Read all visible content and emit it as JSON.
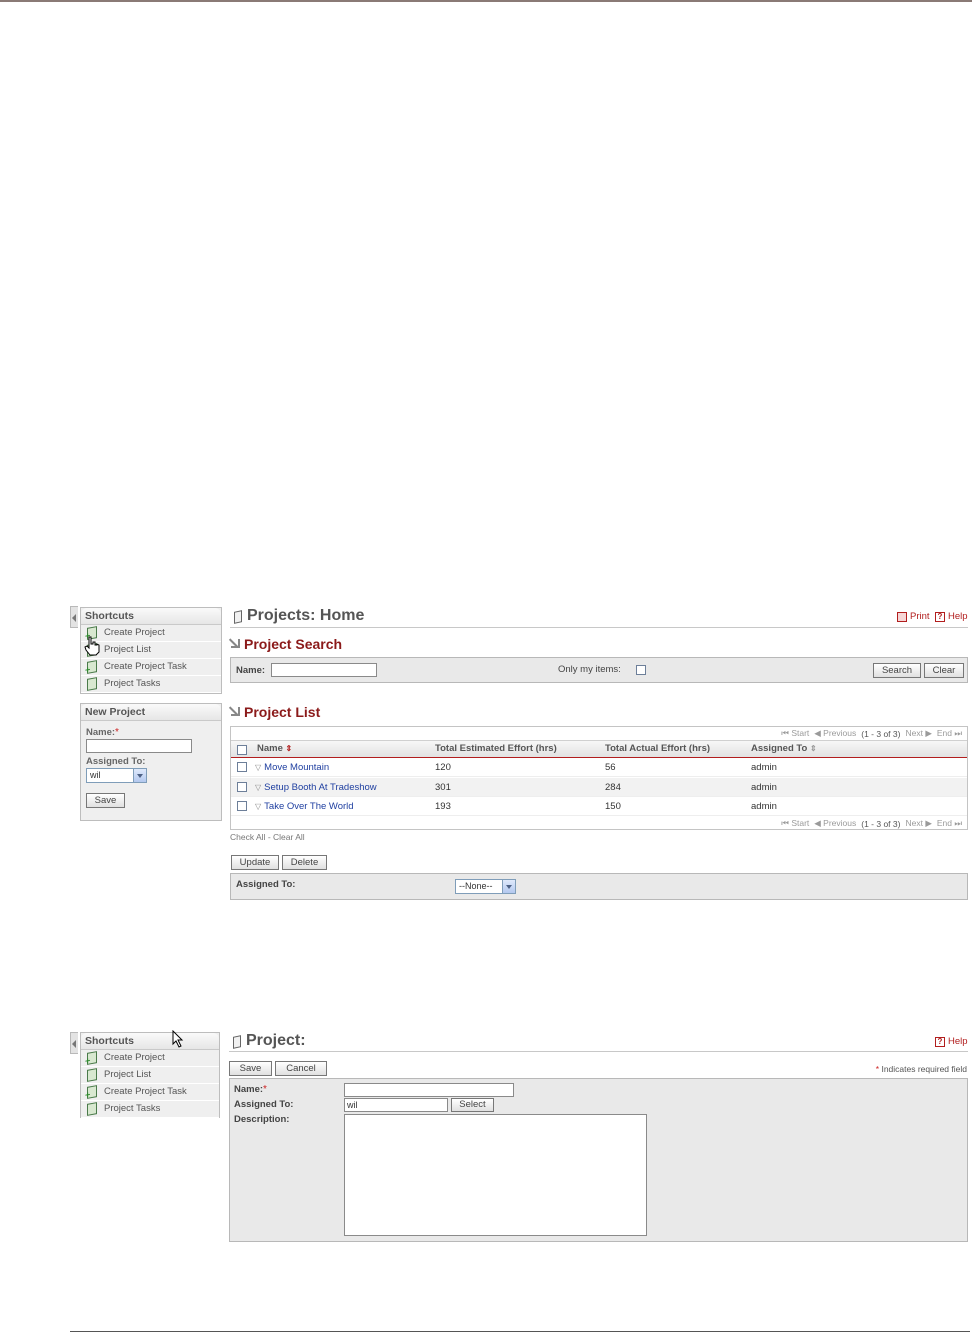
{
  "screen1": {
    "shortcuts": {
      "title": "Shortcuts",
      "items": [
        {
          "label": "Create Project",
          "icon": "book-add-icon"
        },
        {
          "label": "Project List",
          "icon": "book-icon"
        },
        {
          "label": "Create Project Task",
          "icon": "book-add-icon"
        },
        {
          "label": "Project Tasks",
          "icon": "book-icon"
        }
      ]
    },
    "new_project": {
      "title": "New Project",
      "name_label": "Name:",
      "required_mark": "*",
      "name_value": "",
      "assigned_label": "Assigned To:",
      "assigned_value": "wil",
      "save_label": "Save"
    },
    "page_title": "Projects: Home",
    "print_label": "Print",
    "help_label": "Help",
    "search": {
      "title": "Project Search",
      "name_label": "Name:",
      "name_value": "",
      "only_my_label": "Only my items:",
      "search_label": "Search",
      "clear_label": "Clear"
    },
    "list": {
      "title": "Project List",
      "pager": {
        "start": "Start",
        "previous": "Previous",
        "count": "(1 - 3 of 3)",
        "next": "Next",
        "end": "End"
      },
      "columns": [
        "Name",
        "Total Estimated Effort (hrs)",
        "Total Actual Effort (hrs)",
        "Assigned To"
      ],
      "rows": [
        {
          "name": "Move Mountain",
          "estimated": "120",
          "actual": "56",
          "assigned": "admin"
        },
        {
          "name": "Setup Booth At Tradeshow",
          "estimated": "301",
          "actual": "284",
          "assigned": "admin"
        },
        {
          "name": "Take Over The World",
          "estimated": "193",
          "actual": "150",
          "assigned": "admin"
        }
      ],
      "check_all": "Check All",
      "separator": "-",
      "clear_all": "Clear All",
      "update_label": "Update",
      "delete_label": "Delete",
      "assigned_label": "Assigned To:",
      "assigned_value": "--None--"
    }
  },
  "screen2": {
    "shortcuts": {
      "title": "Shortcuts",
      "items": [
        {
          "label": "Create Project",
          "icon": "book-add-icon"
        },
        {
          "label": "Project List",
          "icon": "book-icon"
        },
        {
          "label": "Create Project Task",
          "icon": "book-add-icon"
        },
        {
          "label": "Project Tasks",
          "icon": "book-icon"
        }
      ]
    },
    "page_title": "Project:",
    "help_label": "Help",
    "save_label": "Save",
    "cancel_label": "Cancel",
    "required_note_mark": "*",
    "required_note": "Indicates required field",
    "name_label": "Name:",
    "required_mark": "*",
    "name_value": "",
    "assigned_label": "Assigned To:",
    "assigned_value": "wil",
    "select_label": "Select",
    "description_label": "Description:",
    "description_value": ""
  },
  "colors": {
    "section_title": "#8b1a1a",
    "link": "#1f3fa0",
    "accent_red": "#b21e1e"
  }
}
